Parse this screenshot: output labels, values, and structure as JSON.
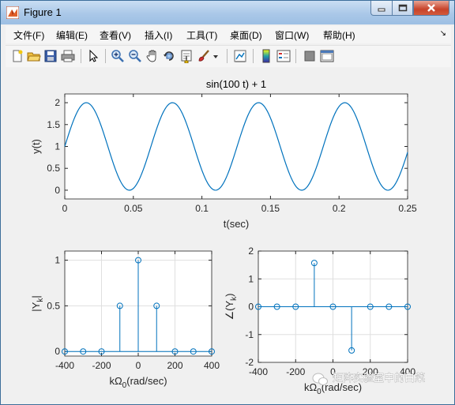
{
  "window": {
    "title": "Figure 1"
  },
  "menu": [
    "文件(F)",
    "编辑(E)",
    "查看(V)",
    "插入(I)",
    "工具(T)",
    "桌面(D)",
    "窗口(W)",
    "帮助(H)"
  ],
  "toolbar": {
    "icons": [
      "new-figure-icon",
      "open-file-icon",
      "save-icon",
      "print-icon",
      "select-arrow-icon",
      "zoom-in-icon",
      "zoom-out-icon",
      "pan-hand-icon",
      "rotate-3d-icon",
      "data-cursor-icon",
      "brush-icon",
      "link-plot-icon",
      "colorbar-icon",
      "legend-icon",
      "hide-plot-tools-icon",
      "show-plot-tools-icon"
    ]
  },
  "watermark": "矩阵实验室中的白菜",
  "colors": {
    "line": "#0072bd",
    "axes": "#262626",
    "grid": "#dfdfdf"
  },
  "chart_data": [
    {
      "type": "line",
      "title": "sin(100 t) + 1",
      "xlabel": "t(sec)",
      "ylabel": "y(t)",
      "xlim": [
        0,
        0.25
      ],
      "ylim": [
        -0.2,
        2.2
      ],
      "xticks": [
        0,
        0.05,
        0.1,
        0.15,
        0.2,
        0.25
      ],
      "xtick_labels": [
        "0",
        "0.05",
        "0.1",
        "0.15",
        "0.2",
        "0.25"
      ],
      "yticks": [
        0,
        0.5,
        1,
        1.5,
        2
      ],
      "ytick_labels": [
        "0",
        "0.5",
        "1",
        "1.5",
        "2"
      ],
      "function": {
        "amplitude": 1,
        "omega": 100,
        "offset": 1
      },
      "grid": false
    },
    {
      "type": "stem",
      "title": "",
      "xlabel": "kΩ0(rad/sec)",
      "ylabel": "|Yk|",
      "xlim": [
        -400,
        400
      ],
      "ylim": [
        -0.05,
        1.1
      ],
      "xticks": [
        -400,
        -200,
        0,
        200,
        400
      ],
      "xtick_labels": [
        "-400",
        "-200",
        "0",
        "200",
        "400"
      ],
      "yticks": [
        0,
        0.5,
        1
      ],
      "ytick_labels": [
        "0",
        "0.5",
        "1"
      ],
      "x": [
        -400,
        -300,
        -200,
        -100,
        0,
        100,
        200,
        300,
        400
      ],
      "y": [
        0,
        0,
        0,
        0.5,
        1,
        0.5,
        0,
        0,
        0
      ],
      "grid": true
    },
    {
      "type": "stem",
      "title": "",
      "xlabel": "kΩ0(rad/sec)",
      "ylabel": "∠(Yk)",
      "xlim": [
        -400,
        400
      ],
      "ylim": [
        -2,
        2
      ],
      "xticks": [
        -400,
        -200,
        0,
        200,
        400
      ],
      "xtick_labels": [
        "-400",
        "-200",
        "0",
        "200",
        "400"
      ],
      "yticks": [
        -2,
        -1,
        0,
        1,
        2
      ],
      "ytick_labels": [
        "-2",
        "-1",
        "0",
        "1",
        "2"
      ],
      "x": [
        -400,
        -300,
        -200,
        -100,
        0,
        100,
        200,
        300,
        400
      ],
      "y": [
        0,
        0,
        0,
        1.5708,
        0,
        -1.5708,
        0,
        0,
        0
      ],
      "grid": true
    }
  ]
}
